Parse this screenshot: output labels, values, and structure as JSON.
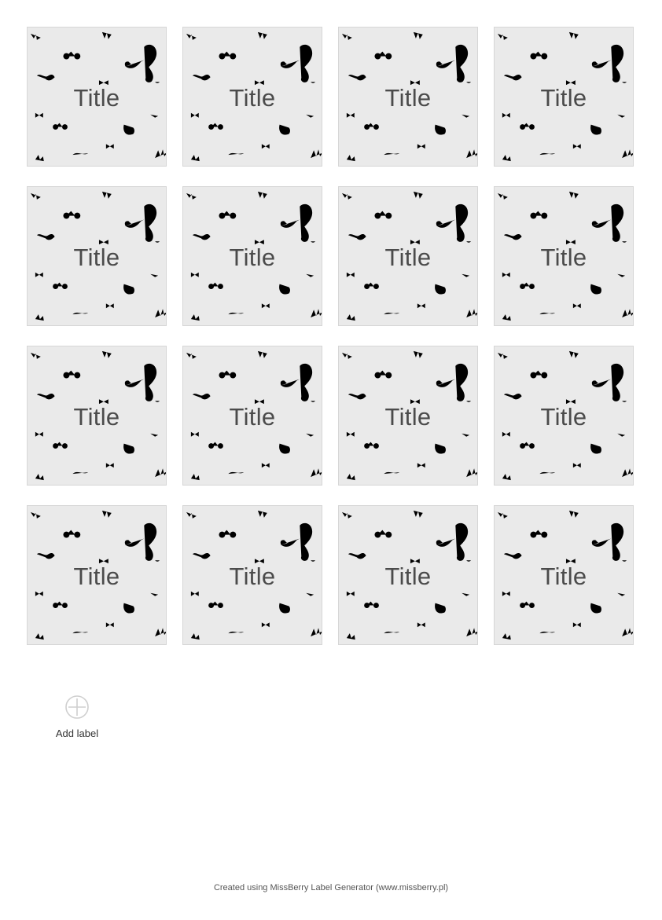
{
  "labels": [
    {
      "title": "Title"
    },
    {
      "title": "Title"
    },
    {
      "title": "Title"
    },
    {
      "title": "Title"
    },
    {
      "title": "Title"
    },
    {
      "title": "Title"
    },
    {
      "title": "Title"
    },
    {
      "title": "Title"
    },
    {
      "title": "Title"
    },
    {
      "title": "Title"
    },
    {
      "title": "Title"
    },
    {
      "title": "Title"
    },
    {
      "title": "Title"
    },
    {
      "title": "Title"
    },
    {
      "title": "Title"
    },
    {
      "title": "Title"
    }
  ],
  "pattern_icons": [
    "bicycle-icon",
    "mustache-icon",
    "pipe-icon",
    "bow-tie-icon",
    "leaf-icon"
  ],
  "add_label": {
    "icon": "plus-circle-icon",
    "text": "Add label"
  },
  "footer": {
    "text": "Created using MissBerry Label Generator (www.missberry.pl)"
  },
  "colors": {
    "card_background": "#eaeaea",
    "card_border": "#d6d6d6",
    "title_text": "#4b4b4b",
    "pattern": "#d4d4d4"
  }
}
